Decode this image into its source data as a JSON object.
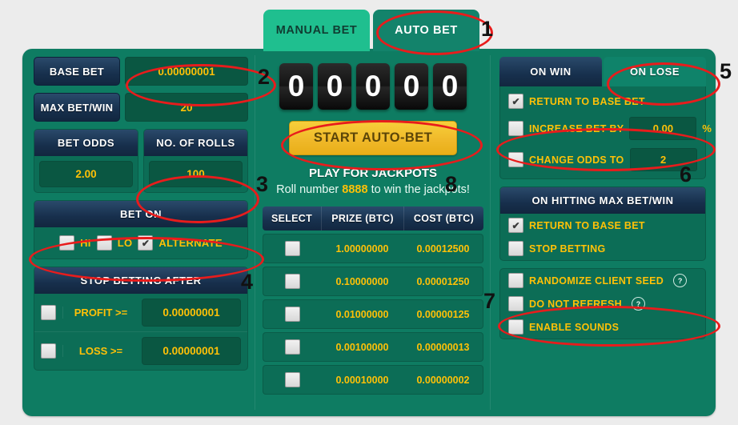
{
  "tabs": [
    {
      "label": "MANUAL BET",
      "active": false
    },
    {
      "label": "AUTO BET",
      "active": true
    }
  ],
  "left_panel": {
    "base_bet": {
      "label": "BASE BET",
      "value": "0.00000001"
    },
    "max_bet_win": {
      "label": "MAX BET/WIN",
      "value": "20"
    },
    "bet_odds": {
      "label": "BET ODDS",
      "value": "2.00"
    },
    "no_of_rolls": {
      "label": "NO. OF ROLLS",
      "value": "100"
    },
    "bet_on": {
      "title": "BET ON",
      "options": [
        {
          "label": "HI",
          "checked": false
        },
        {
          "label": "LO",
          "checked": false
        },
        {
          "label": "ALTERNATE",
          "checked": true
        }
      ]
    },
    "stop_betting_after": {
      "title": "STOP BETTING AFTER",
      "rows": [
        {
          "label": "PROFIT >=",
          "value": "0.00000001",
          "checked": false
        },
        {
          "label": "LOSS >=",
          "value": "0.00000001",
          "checked": false
        }
      ]
    }
  },
  "middle_panel": {
    "digits": [
      "0",
      "0",
      "0",
      "0",
      "0"
    ],
    "start_button": "START AUTO-BET",
    "jackpot_title": "PLAY FOR JACKPOTS",
    "jackpot_sub_pre": "Roll number ",
    "jackpot_number": "8888",
    "jackpot_sub_post": " to win the jackpots!",
    "table": {
      "headers": [
        "SELECT",
        "PRIZE (BTC)",
        "COST (BTC)"
      ],
      "rows": [
        {
          "selected": false,
          "prize": "1.00000000",
          "cost": "0.00012500"
        },
        {
          "selected": false,
          "prize": "0.10000000",
          "cost": "0.00001250"
        },
        {
          "selected": false,
          "prize": "0.01000000",
          "cost": "0.00000125"
        },
        {
          "selected": false,
          "prize": "0.00100000",
          "cost": "0.00000013"
        },
        {
          "selected": false,
          "prize": "0.00010000",
          "cost": "0.00000002"
        }
      ]
    }
  },
  "right_panel": {
    "segments": [
      {
        "label": "ON WIN",
        "active": true
      },
      {
        "label": "ON LOSE",
        "active": false
      }
    ],
    "on_win_options": {
      "return_to_base_bet": {
        "label": "RETURN TO BASE BET",
        "checked": true
      },
      "increase_bet_by": {
        "label": "INCREASE BET BY",
        "value": "0.00",
        "unit": "%",
        "checked": false
      },
      "change_odds_to": {
        "label": "CHANGE ODDS TO",
        "value": "2",
        "checked": false
      }
    },
    "max_bet_win_panel": {
      "title": "ON HITTING MAX BET/WIN",
      "options": [
        {
          "label": "RETURN TO BASE BET",
          "checked": true
        },
        {
          "label": "STOP BETTING",
          "checked": false
        }
      ]
    },
    "misc_options": [
      {
        "label": "RANDOMIZE CLIENT SEED",
        "checked": false,
        "help": "?"
      },
      {
        "label": "DO NOT REFRESH",
        "checked": false,
        "help": "?"
      },
      {
        "label": "ENABLE SOUNDS",
        "checked": false,
        "help": ""
      }
    ]
  },
  "annotations": {
    "numbers": [
      "1",
      "2",
      "3",
      "4",
      "5",
      "6",
      "7",
      "8"
    ],
    "color": "#e81c1c"
  }
}
